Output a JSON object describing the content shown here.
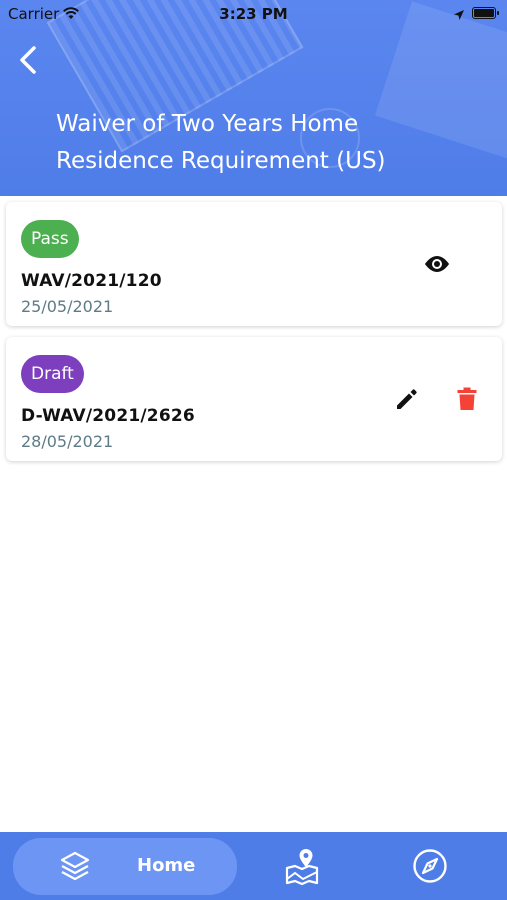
{
  "status_bar": {
    "carrier": "Carrier",
    "time": "3:23 PM"
  },
  "header": {
    "title_line1": "Waiver of Two Years Home",
    "title_line2": "Residence Requirement (US)",
    "back_icon": "chevron-left-icon"
  },
  "applications": [
    {
      "status": "Pass",
      "status_color": "#4caf50",
      "reference": "WAV/2021/120",
      "date": "25/05/2021",
      "actions": [
        "eye-icon"
      ]
    },
    {
      "status": "Draft",
      "status_color": "#7e3fbf",
      "reference": "D-WAV/2021/2626",
      "date": "28/05/2021",
      "actions": [
        "pencil-icon",
        "trash-icon"
      ]
    }
  ],
  "bottom_nav": {
    "home_label": "Home",
    "items": [
      "layers-icon",
      "map-pin-icon",
      "compass-icon"
    ],
    "background": "#4f7de8",
    "active_background": "#6d95f3"
  }
}
